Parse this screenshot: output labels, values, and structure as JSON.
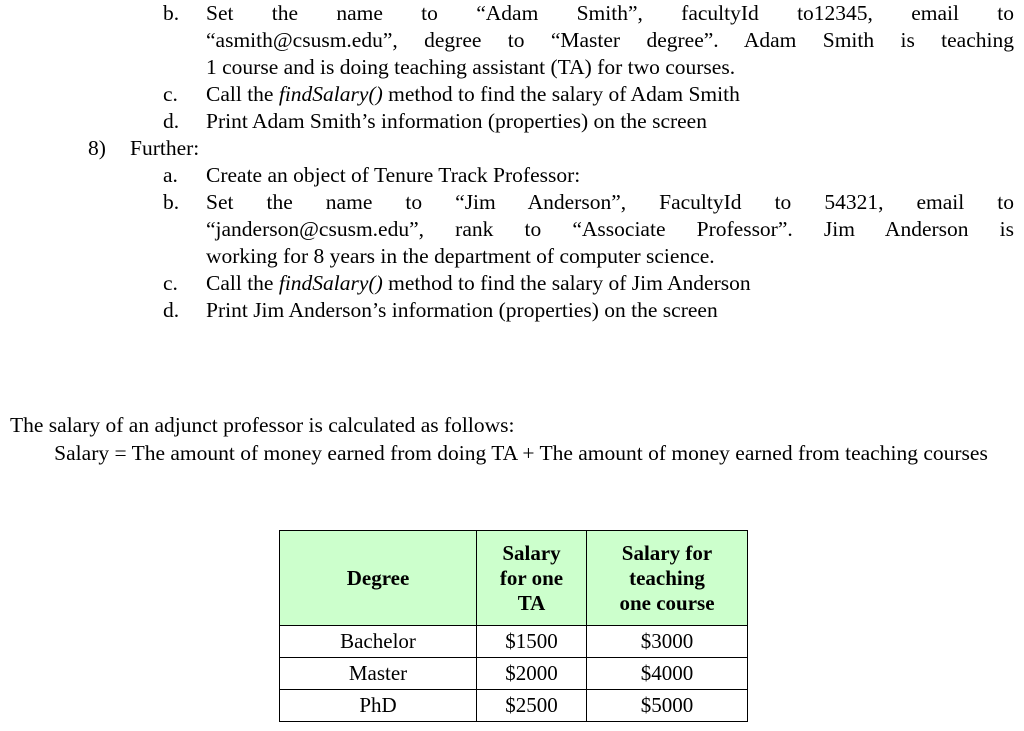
{
  "document": {
    "outline": [
      {
        "type": "letter",
        "marker": "b.",
        "justified": true,
        "lines": [
          {
            "text": "Set the name to “Adam Smith”, facultyId to12345, email to",
            "stretch": true
          },
          {
            "text": "“asmith@csusm.edu”, degree to “Master degree”. Adam Smith is teaching",
            "stretch": true
          },
          {
            "text": "1 course and is doing teaching assistant (TA) for two courses.",
            "stretch": false
          }
        ]
      },
      {
        "type": "letter",
        "marker": "c.",
        "justified": false,
        "pre_italic": "Call the ",
        "italic": "findSalary()",
        "post_italic": " method to find the salary of Adam Smith"
      },
      {
        "type": "letter",
        "marker": "d.",
        "justified": false,
        "text": "Print Adam Smith’s information (properties) on the screen"
      },
      {
        "type": "number",
        "marker": "8)",
        "text": "Further:"
      },
      {
        "type": "letter",
        "marker": "a.",
        "justified": false,
        "text": "Create an object of Tenure Track Professor:"
      },
      {
        "type": "letter",
        "marker": "b.",
        "justified": true,
        "lines": [
          {
            "text": "Set the name to “Jim Anderson”, FacultyId to 54321, email to",
            "stretch": true
          },
          {
            "text": "“janderson@csusm.edu”, rank to “Associate Professor”. Jim Anderson is",
            "stretch": true
          },
          {
            "text": "working for 8 years in the department of computer science.",
            "stretch": false
          }
        ]
      },
      {
        "type": "letter",
        "marker": "c.",
        "justified": false,
        "pre_italic": "Call the ",
        "italic": "findSalary()",
        "post_italic": " method to find the salary of Jim Anderson"
      },
      {
        "type": "letter",
        "marker": "d.",
        "justified": false,
        "text": "Print Jim Anderson’s information (properties) on the screen"
      }
    ],
    "salary_note": {
      "line1": "The salary of an adjunct professor is calculated as follows:",
      "line2": "Salary = The amount of money earned from doing TA + The amount of money earned from teaching courses"
    },
    "salary_table": {
      "headers": [
        "Degree",
        "Salary for one TA",
        "Salary for teaching one course"
      ],
      "header_lines": [
        [
          "Degree"
        ],
        [
          "Salary",
          "for one",
          "TA"
        ],
        [
          "Salary for",
          "teaching",
          "one course"
        ]
      ],
      "rows": [
        [
          "Bachelor",
          "$1500",
          "$3000"
        ],
        [
          "Master",
          "$2000",
          "$4000"
        ],
        [
          "PhD",
          "$2500",
          "$5000"
        ]
      ],
      "header_background": "#CCFFCC",
      "border_color": "#000000"
    }
  }
}
